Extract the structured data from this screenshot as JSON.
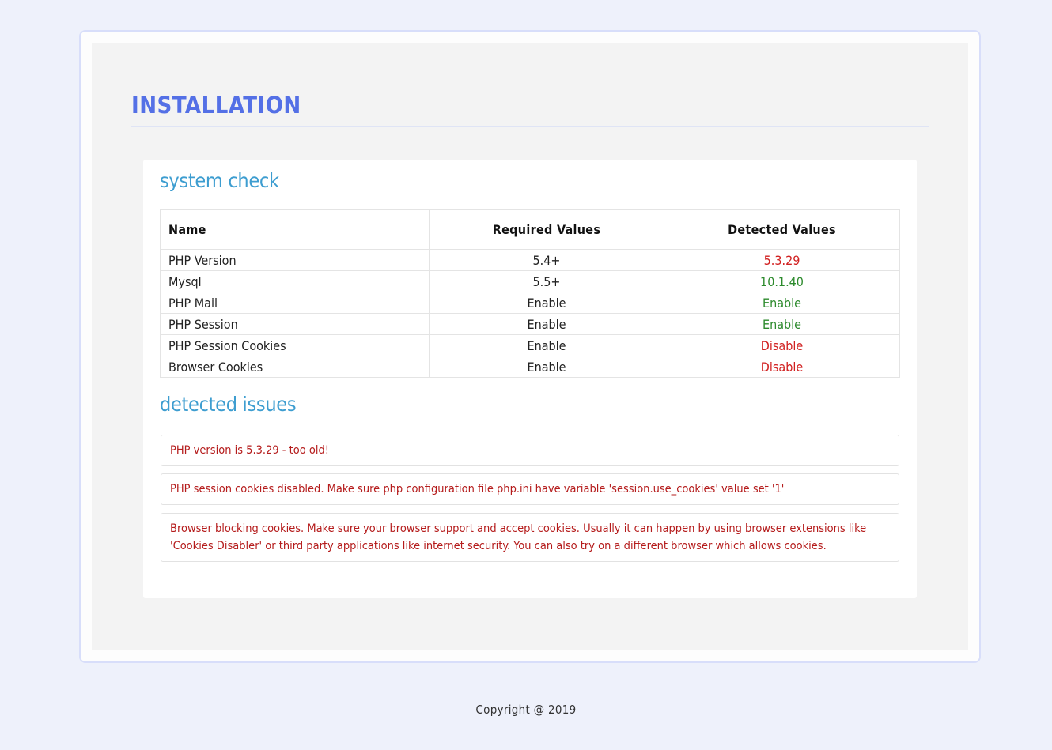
{
  "page": {
    "title": "INSTALLATION"
  },
  "system_check": {
    "heading": "system check",
    "columns": {
      "name": "Name",
      "required": "Required Values",
      "detected": "Detected Values"
    },
    "rows": [
      {
        "name": "PHP Version",
        "required": "5.4+",
        "detected": "5.3.29",
        "status": "fail"
      },
      {
        "name": "Mysql",
        "required": "5.5+",
        "detected": "10.1.40",
        "status": "ok"
      },
      {
        "name": "PHP Mail",
        "required": "Enable",
        "detected": "Enable",
        "status": "ok"
      },
      {
        "name": "PHP Session",
        "required": "Enable",
        "detected": "Enable",
        "status": "ok"
      },
      {
        "name": "PHP Session Cookies",
        "required": "Enable",
        "detected": "Disable",
        "status": "fail"
      },
      {
        "name": "Browser Cookies",
        "required": "Enable",
        "detected": "Disable",
        "status": "fail"
      }
    ]
  },
  "detected_issues": {
    "heading": "detected issues",
    "items": [
      "PHP version is 5.3.29 - too old!",
      "PHP session cookies disabled. Make sure php configuration file php.ini have variable 'session.use_cookies' value set '1'",
      "Browser blocking cookies. Make sure your browser support and accept cookies. Usually it can happen by using browser extensions like 'Cookies Disabler' or third party applications like internet security. You can also try on a different browser which allows cookies."
    ]
  },
  "footer": {
    "copyright": "Copyright @ 2019"
  },
  "colors": {
    "background": "#eef1fb",
    "title": "#5470e6",
    "section_heading": "#3d9dd0",
    "status_ok": "#2c8a2c",
    "status_fail": "#d12020",
    "issue_text": "#b51c1c"
  }
}
